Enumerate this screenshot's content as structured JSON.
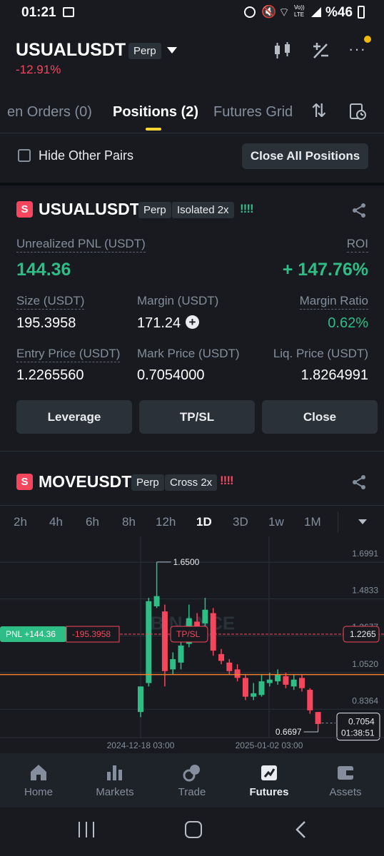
{
  "status_bar": {
    "time": "01:21",
    "battery": "%46",
    "lte": "Vo)) LTE"
  },
  "header": {
    "symbol": "USUALUSDT",
    "type": "Perp",
    "change": "-12.91%"
  },
  "tabs": [
    "en Orders (0)",
    "Positions (2)",
    "Futures Grid"
  ],
  "filter": {
    "hide_label": "Hide Other Pairs",
    "close_all": "Close All Positions"
  },
  "position1": {
    "symbol": "USUALUSDT",
    "type": "Perp",
    "margin_mode": "Isolated 2x",
    "risk": "!!!!",
    "pnl_label": "Unrealized PNL (USDT)",
    "pnl_value": "144.36",
    "roi_label": "ROI",
    "roi_value": "+ 147.76%",
    "size_label": "Size (USDT)",
    "size_value": "195.3958",
    "margin_label": "Margin (USDT)",
    "margin_value": "171.24",
    "ratio_label": "Margin Ratio",
    "ratio_value": "0.62%",
    "entry_label": "Entry Price (USDT)",
    "entry_value": "1.2265560",
    "mark_label": "Mark Price (USDT)",
    "mark_value": "0.7054000",
    "liq_label": "Liq. Price (USDT)",
    "liq_value": "1.8264991",
    "buttons": [
      "Leverage",
      "TP/SL",
      "Close"
    ]
  },
  "position2": {
    "symbol": "MOVEUSDT",
    "type": "Perp",
    "margin_mode": "Cross 2x",
    "risk": "!!!!"
  },
  "timeframes": [
    "2h",
    "4h",
    "6h",
    "8h",
    "12h",
    "1D",
    "3D",
    "1w",
    "1M"
  ],
  "chart": {
    "high_label": "1.6500",
    "low_label": "0.6697",
    "pnl_tag": "PNL +144.36",
    "size_tag": "-195.3958",
    "tpsl_tag": "TP/SL",
    "entry_tag": "1.2265",
    "price_tag": "0.7054",
    "countdown": "01:38:51",
    "watermark": "BINANCE",
    "x_labels": [
      "2024-12-18 03:00",
      "2025-01-02 03:00"
    ]
  },
  "chart_data": {
    "type": "candlestick",
    "ylim": [
      0.62,
      1.8
    ],
    "y_ticks": [
      1.6991,
      1.4833,
      1.2677,
      1.052,
      0.8364
    ],
    "y_tick_labels": [
      "1.6991",
      "1.4833",
      "1.2677",
      "1.0520",
      "0.8364"
    ],
    "entry_price": 1.2265,
    "current_price": 0.7054,
    "orange_line": 0.99,
    "candles": [
      {
        "o": 0.77,
        "c": 0.92,
        "h": 0.92,
        "l": 0.74
      },
      {
        "o": 0.94,
        "c": 1.42,
        "h": 1.44,
        "l": 0.92
      },
      {
        "o": 1.39,
        "c": 1.45,
        "h": 1.65,
        "l": 1.38
      },
      {
        "o": 1.36,
        "c": 1.01,
        "h": 1.4,
        "l": 0.92
      },
      {
        "o": 1.02,
        "c": 1.08,
        "h": 1.12,
        "l": 0.99
      },
      {
        "o": 1.06,
        "c": 1.16,
        "h": 1.18,
        "l": 1.02
      },
      {
        "o": 1.17,
        "c": 1.32,
        "h": 1.4,
        "l": 1.15
      },
      {
        "o": 1.3,
        "c": 1.24,
        "h": 1.35,
        "l": 1.2
      },
      {
        "o": 1.29,
        "c": 1.37,
        "h": 1.44,
        "l": 1.26
      },
      {
        "o": 1.35,
        "c": 1.13,
        "h": 1.38,
        "l": 1.1
      },
      {
        "o": 1.11,
        "c": 1.07,
        "h": 1.14,
        "l": 1.05
      },
      {
        "o": 1.06,
        "c": 1.01,
        "h": 1.08,
        "l": 0.99
      },
      {
        "o": 1.02,
        "c": 0.97,
        "h": 1.05,
        "l": 0.95
      },
      {
        "o": 0.97,
        "c": 0.86,
        "h": 0.99,
        "l": 0.84
      },
      {
        "o": 0.86,
        "c": 0.88,
        "h": 0.94,
        "l": 0.84
      },
      {
        "o": 0.87,
        "c": 0.95,
        "h": 0.99,
        "l": 0.86
      },
      {
        "o": 0.94,
        "c": 0.96,
        "h": 1.0,
        "l": 0.92
      },
      {
        "o": 0.95,
        "c": 0.99,
        "h": 1.02,
        "l": 0.93
      },
      {
        "o": 0.98,
        "c": 0.93,
        "h": 1.0,
        "l": 0.91
      },
      {
        "o": 0.92,
        "c": 0.96,
        "h": 0.99,
        "l": 0.9
      },
      {
        "o": 0.97,
        "c": 0.91,
        "h": 0.99,
        "l": 0.89
      },
      {
        "o": 0.9,
        "c": 0.78,
        "h": 0.91,
        "l": 0.76
      },
      {
        "o": 0.77,
        "c": 0.7,
        "h": 0.77,
        "l": 0.67
      }
    ]
  },
  "bottom_nav": [
    "Home",
    "Markets",
    "Trade",
    "Futures",
    "Assets"
  ],
  "colors": {
    "up": "#2ebd85",
    "down": "#f6465d",
    "accent": "#fcd535",
    "bg": "#181a20"
  }
}
